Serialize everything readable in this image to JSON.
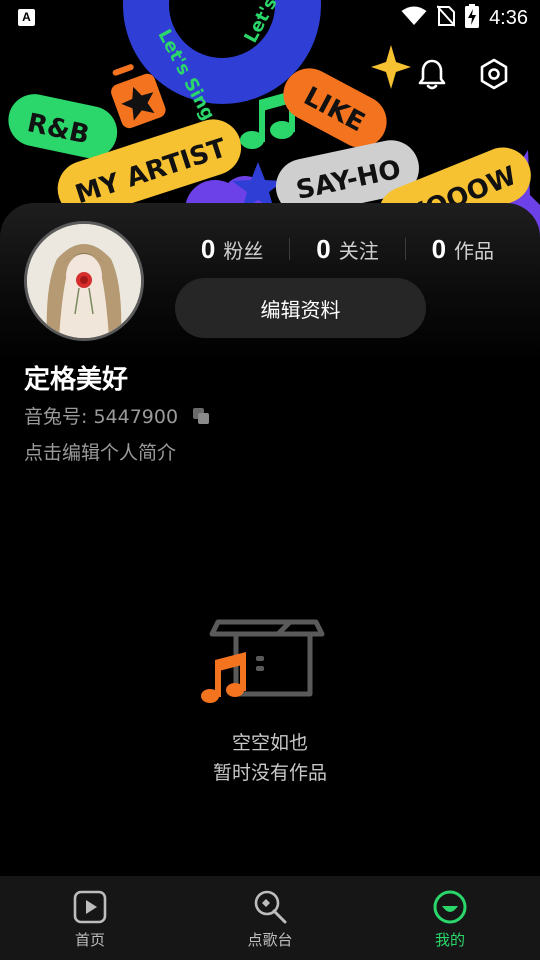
{
  "status_bar": {
    "app_indicator": "A",
    "time": "4:36",
    "icons": [
      "wifi-icon",
      "no-sim-icon",
      "battery-charging-icon"
    ]
  },
  "banner": {
    "stickers": [
      "Let's Sing",
      "R&B",
      "MY ARTIST",
      "LIKE",
      "SAY-HO",
      "WOOOW"
    ],
    "actions": [
      "notification-bell-icon",
      "settings-hexagon-icon"
    ]
  },
  "profile": {
    "stats": [
      {
        "count": "0",
        "label": "粉丝"
      },
      {
        "count": "0",
        "label": "关注"
      },
      {
        "count": "0",
        "label": "作品"
      }
    ],
    "edit_button_label": "编辑资料",
    "nickname": "定格美好",
    "uid_label": "音兔号: 5447900",
    "bio_placeholder": "点击编辑个人简介"
  },
  "empty_state": {
    "title": "空空如也",
    "subtitle": "暂时没有作品"
  },
  "bottom_nav": {
    "items": [
      {
        "label": "首页",
        "icon": "play-square-icon",
        "active": false
      },
      {
        "label": "点歌台",
        "icon": "microphone-icon",
        "active": false
      },
      {
        "label": "我的",
        "icon": "smile-face-icon",
        "active": true
      }
    ]
  },
  "colors": {
    "accent": "#2bd66a",
    "sticker_green": "#2bd66a",
    "sticker_yellow": "#f7c231",
    "sticker_orange": "#f4731f",
    "sticker_purple": "#6c42e8",
    "sticker_blue": "#2f3fd6",
    "sticker_gray": "#cfcfcf",
    "empty_note_orange": "#f4731f"
  }
}
